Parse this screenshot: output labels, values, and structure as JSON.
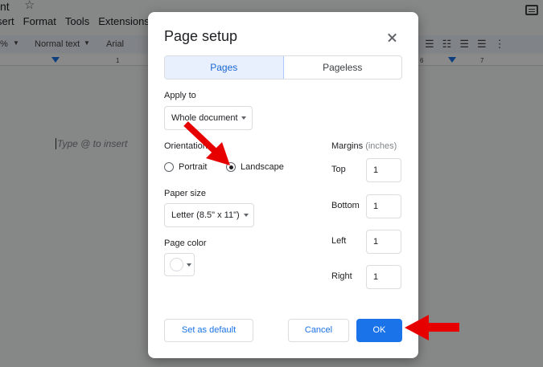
{
  "app": {
    "title": "nt",
    "menu": [
      "sert",
      "Format",
      "Tools",
      "Extensions"
    ],
    "toolbar": {
      "zoom": "%",
      "style": "Normal text",
      "font": "Arial"
    },
    "ruler": {
      "n1": "1",
      "n6": "6",
      "n7": "7"
    },
    "doc_hint": "Type @ to insert"
  },
  "dialog": {
    "title": "Page setup",
    "tabs": [
      {
        "label": "Pages",
        "active": true
      },
      {
        "label": "Pageless",
        "active": false
      }
    ],
    "apply_to": {
      "label": "Apply to",
      "value": "Whole document"
    },
    "orientation": {
      "label": "Orientation",
      "options": [
        {
          "label": "Portrait",
          "checked": false
        },
        {
          "label": "Landscape",
          "checked": true
        }
      ]
    },
    "paper_size": {
      "label": "Paper size",
      "value": "Letter (8.5\" x 11\")"
    },
    "page_color": {
      "label": "Page color",
      "value": "#ffffff"
    },
    "margins": {
      "label": "Margins",
      "unit": "(inches)",
      "fields": [
        {
          "label": "Top",
          "value": "1"
        },
        {
          "label": "Bottom",
          "value": "1"
        },
        {
          "label": "Left",
          "value": "1"
        },
        {
          "label": "Right",
          "value": "1"
        }
      ]
    },
    "buttons": {
      "default": "Set as default",
      "cancel": "Cancel",
      "ok": "OK"
    }
  },
  "colors": {
    "accent": "#1a73e8",
    "annotation": "#e60000"
  }
}
